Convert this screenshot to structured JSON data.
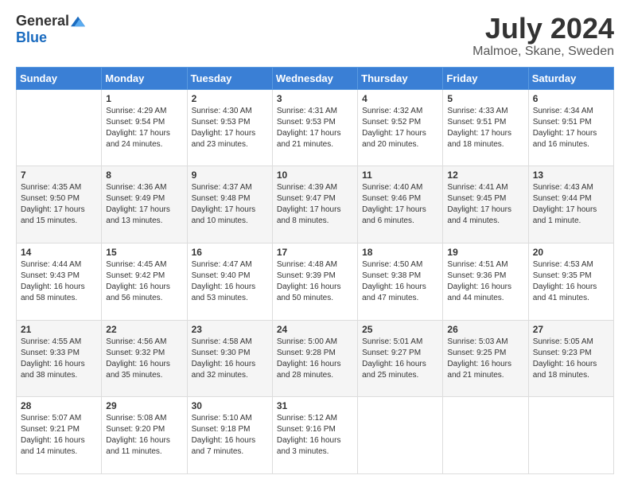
{
  "logo": {
    "general": "General",
    "blue": "Blue"
  },
  "title": "July 2024",
  "location": "Malmoe, Skane, Sweden",
  "days_of_week": [
    "Sunday",
    "Monday",
    "Tuesday",
    "Wednesday",
    "Thursday",
    "Friday",
    "Saturday"
  ],
  "weeks": [
    [
      {
        "day": "",
        "info": ""
      },
      {
        "day": "1",
        "info": "Sunrise: 4:29 AM\nSunset: 9:54 PM\nDaylight: 17 hours and 24 minutes."
      },
      {
        "day": "2",
        "info": "Sunrise: 4:30 AM\nSunset: 9:53 PM\nDaylight: 17 hours and 23 minutes."
      },
      {
        "day": "3",
        "info": "Sunrise: 4:31 AM\nSunset: 9:53 PM\nDaylight: 17 hours and 21 minutes."
      },
      {
        "day": "4",
        "info": "Sunrise: 4:32 AM\nSunset: 9:52 PM\nDaylight: 17 hours and 20 minutes."
      },
      {
        "day": "5",
        "info": "Sunrise: 4:33 AM\nSunset: 9:51 PM\nDaylight: 17 hours and 18 minutes."
      },
      {
        "day": "6",
        "info": "Sunrise: 4:34 AM\nSunset: 9:51 PM\nDaylight: 17 hours and 16 minutes."
      }
    ],
    [
      {
        "day": "7",
        "info": "Sunrise: 4:35 AM\nSunset: 9:50 PM\nDaylight: 17 hours and 15 minutes."
      },
      {
        "day": "8",
        "info": "Sunrise: 4:36 AM\nSunset: 9:49 PM\nDaylight: 17 hours and 13 minutes."
      },
      {
        "day": "9",
        "info": "Sunrise: 4:37 AM\nSunset: 9:48 PM\nDaylight: 17 hours and 10 minutes."
      },
      {
        "day": "10",
        "info": "Sunrise: 4:39 AM\nSunset: 9:47 PM\nDaylight: 17 hours and 8 minutes."
      },
      {
        "day": "11",
        "info": "Sunrise: 4:40 AM\nSunset: 9:46 PM\nDaylight: 17 hours and 6 minutes."
      },
      {
        "day": "12",
        "info": "Sunrise: 4:41 AM\nSunset: 9:45 PM\nDaylight: 17 hours and 4 minutes."
      },
      {
        "day": "13",
        "info": "Sunrise: 4:43 AM\nSunset: 9:44 PM\nDaylight: 17 hours and 1 minute."
      }
    ],
    [
      {
        "day": "14",
        "info": "Sunrise: 4:44 AM\nSunset: 9:43 PM\nDaylight: 16 hours and 58 minutes."
      },
      {
        "day": "15",
        "info": "Sunrise: 4:45 AM\nSunset: 9:42 PM\nDaylight: 16 hours and 56 minutes."
      },
      {
        "day": "16",
        "info": "Sunrise: 4:47 AM\nSunset: 9:40 PM\nDaylight: 16 hours and 53 minutes."
      },
      {
        "day": "17",
        "info": "Sunrise: 4:48 AM\nSunset: 9:39 PM\nDaylight: 16 hours and 50 minutes."
      },
      {
        "day": "18",
        "info": "Sunrise: 4:50 AM\nSunset: 9:38 PM\nDaylight: 16 hours and 47 minutes."
      },
      {
        "day": "19",
        "info": "Sunrise: 4:51 AM\nSunset: 9:36 PM\nDaylight: 16 hours and 44 minutes."
      },
      {
        "day": "20",
        "info": "Sunrise: 4:53 AM\nSunset: 9:35 PM\nDaylight: 16 hours and 41 minutes."
      }
    ],
    [
      {
        "day": "21",
        "info": "Sunrise: 4:55 AM\nSunset: 9:33 PM\nDaylight: 16 hours and 38 minutes."
      },
      {
        "day": "22",
        "info": "Sunrise: 4:56 AM\nSunset: 9:32 PM\nDaylight: 16 hours and 35 minutes."
      },
      {
        "day": "23",
        "info": "Sunrise: 4:58 AM\nSunset: 9:30 PM\nDaylight: 16 hours and 32 minutes."
      },
      {
        "day": "24",
        "info": "Sunrise: 5:00 AM\nSunset: 9:28 PM\nDaylight: 16 hours and 28 minutes."
      },
      {
        "day": "25",
        "info": "Sunrise: 5:01 AM\nSunset: 9:27 PM\nDaylight: 16 hours and 25 minutes."
      },
      {
        "day": "26",
        "info": "Sunrise: 5:03 AM\nSunset: 9:25 PM\nDaylight: 16 hours and 21 minutes."
      },
      {
        "day": "27",
        "info": "Sunrise: 5:05 AM\nSunset: 9:23 PM\nDaylight: 16 hours and 18 minutes."
      }
    ],
    [
      {
        "day": "28",
        "info": "Sunrise: 5:07 AM\nSunset: 9:21 PM\nDaylight: 16 hours and 14 minutes."
      },
      {
        "day": "29",
        "info": "Sunrise: 5:08 AM\nSunset: 9:20 PM\nDaylight: 16 hours and 11 minutes."
      },
      {
        "day": "30",
        "info": "Sunrise: 5:10 AM\nSunset: 9:18 PM\nDaylight: 16 hours and 7 minutes."
      },
      {
        "day": "31",
        "info": "Sunrise: 5:12 AM\nSunset: 9:16 PM\nDaylight: 16 hours and 3 minutes."
      },
      {
        "day": "",
        "info": ""
      },
      {
        "day": "",
        "info": ""
      },
      {
        "day": "",
        "info": ""
      }
    ]
  ]
}
